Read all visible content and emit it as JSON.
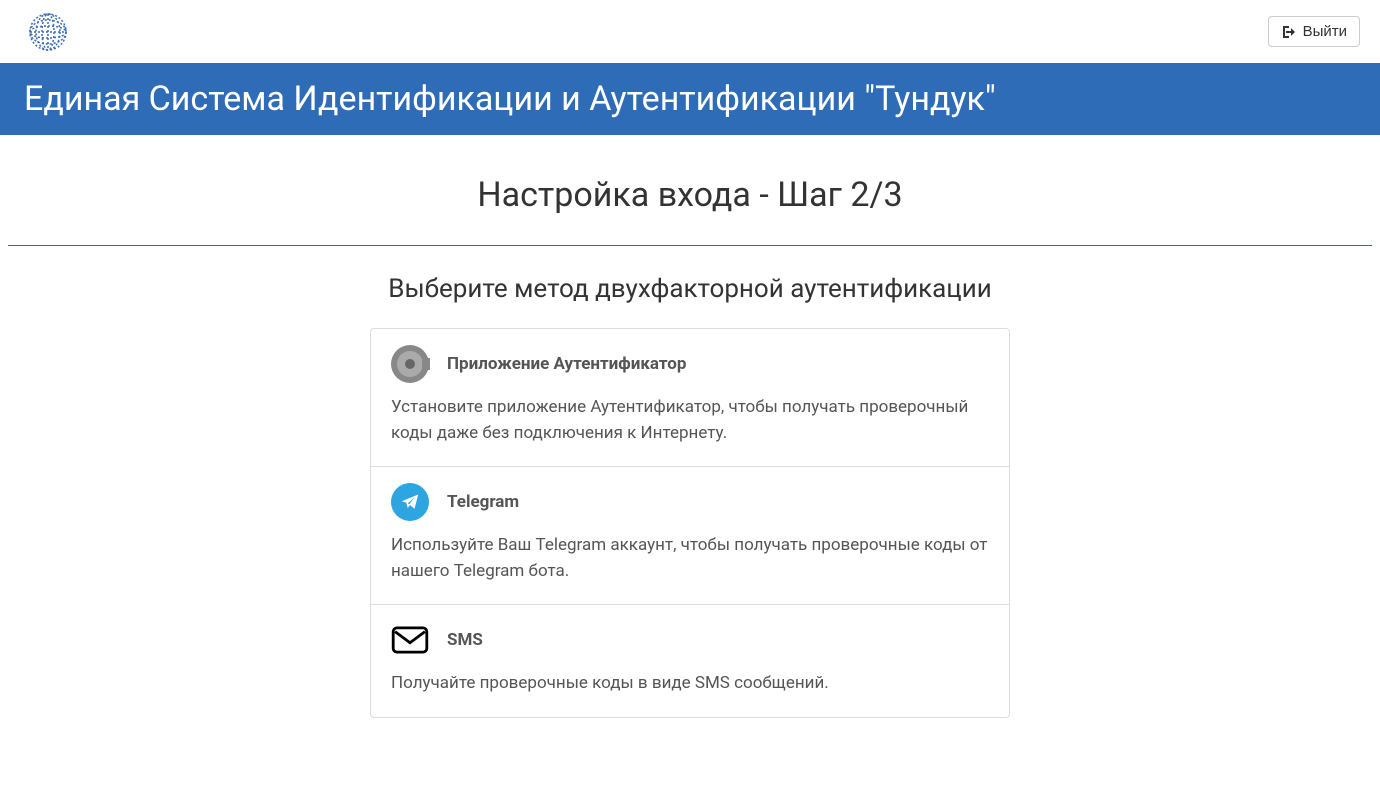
{
  "header": {
    "logout_label": "Выйти"
  },
  "banner": {
    "title": "Единая Система Идентификации и Аутентификации \"Тундук\""
  },
  "main": {
    "step_title": "Настройка входа - Шаг 2/3",
    "subtitle": "Выберите метод двухфакторной аутентификации",
    "options": [
      {
        "title": "Приложение Аутентификатор",
        "description": "Установите приложение Аутентификатор, чтобы получать проверочный коды даже без подключения к Интернету."
      },
      {
        "title": "Telegram",
        "description": "Используйте Ваш Telegram аккаунт, чтобы получать проверочные коды от нашего Telegram бота."
      },
      {
        "title": "SMS",
        "description": "Получайте проверочные коды в виде SMS сообщений."
      }
    ]
  }
}
